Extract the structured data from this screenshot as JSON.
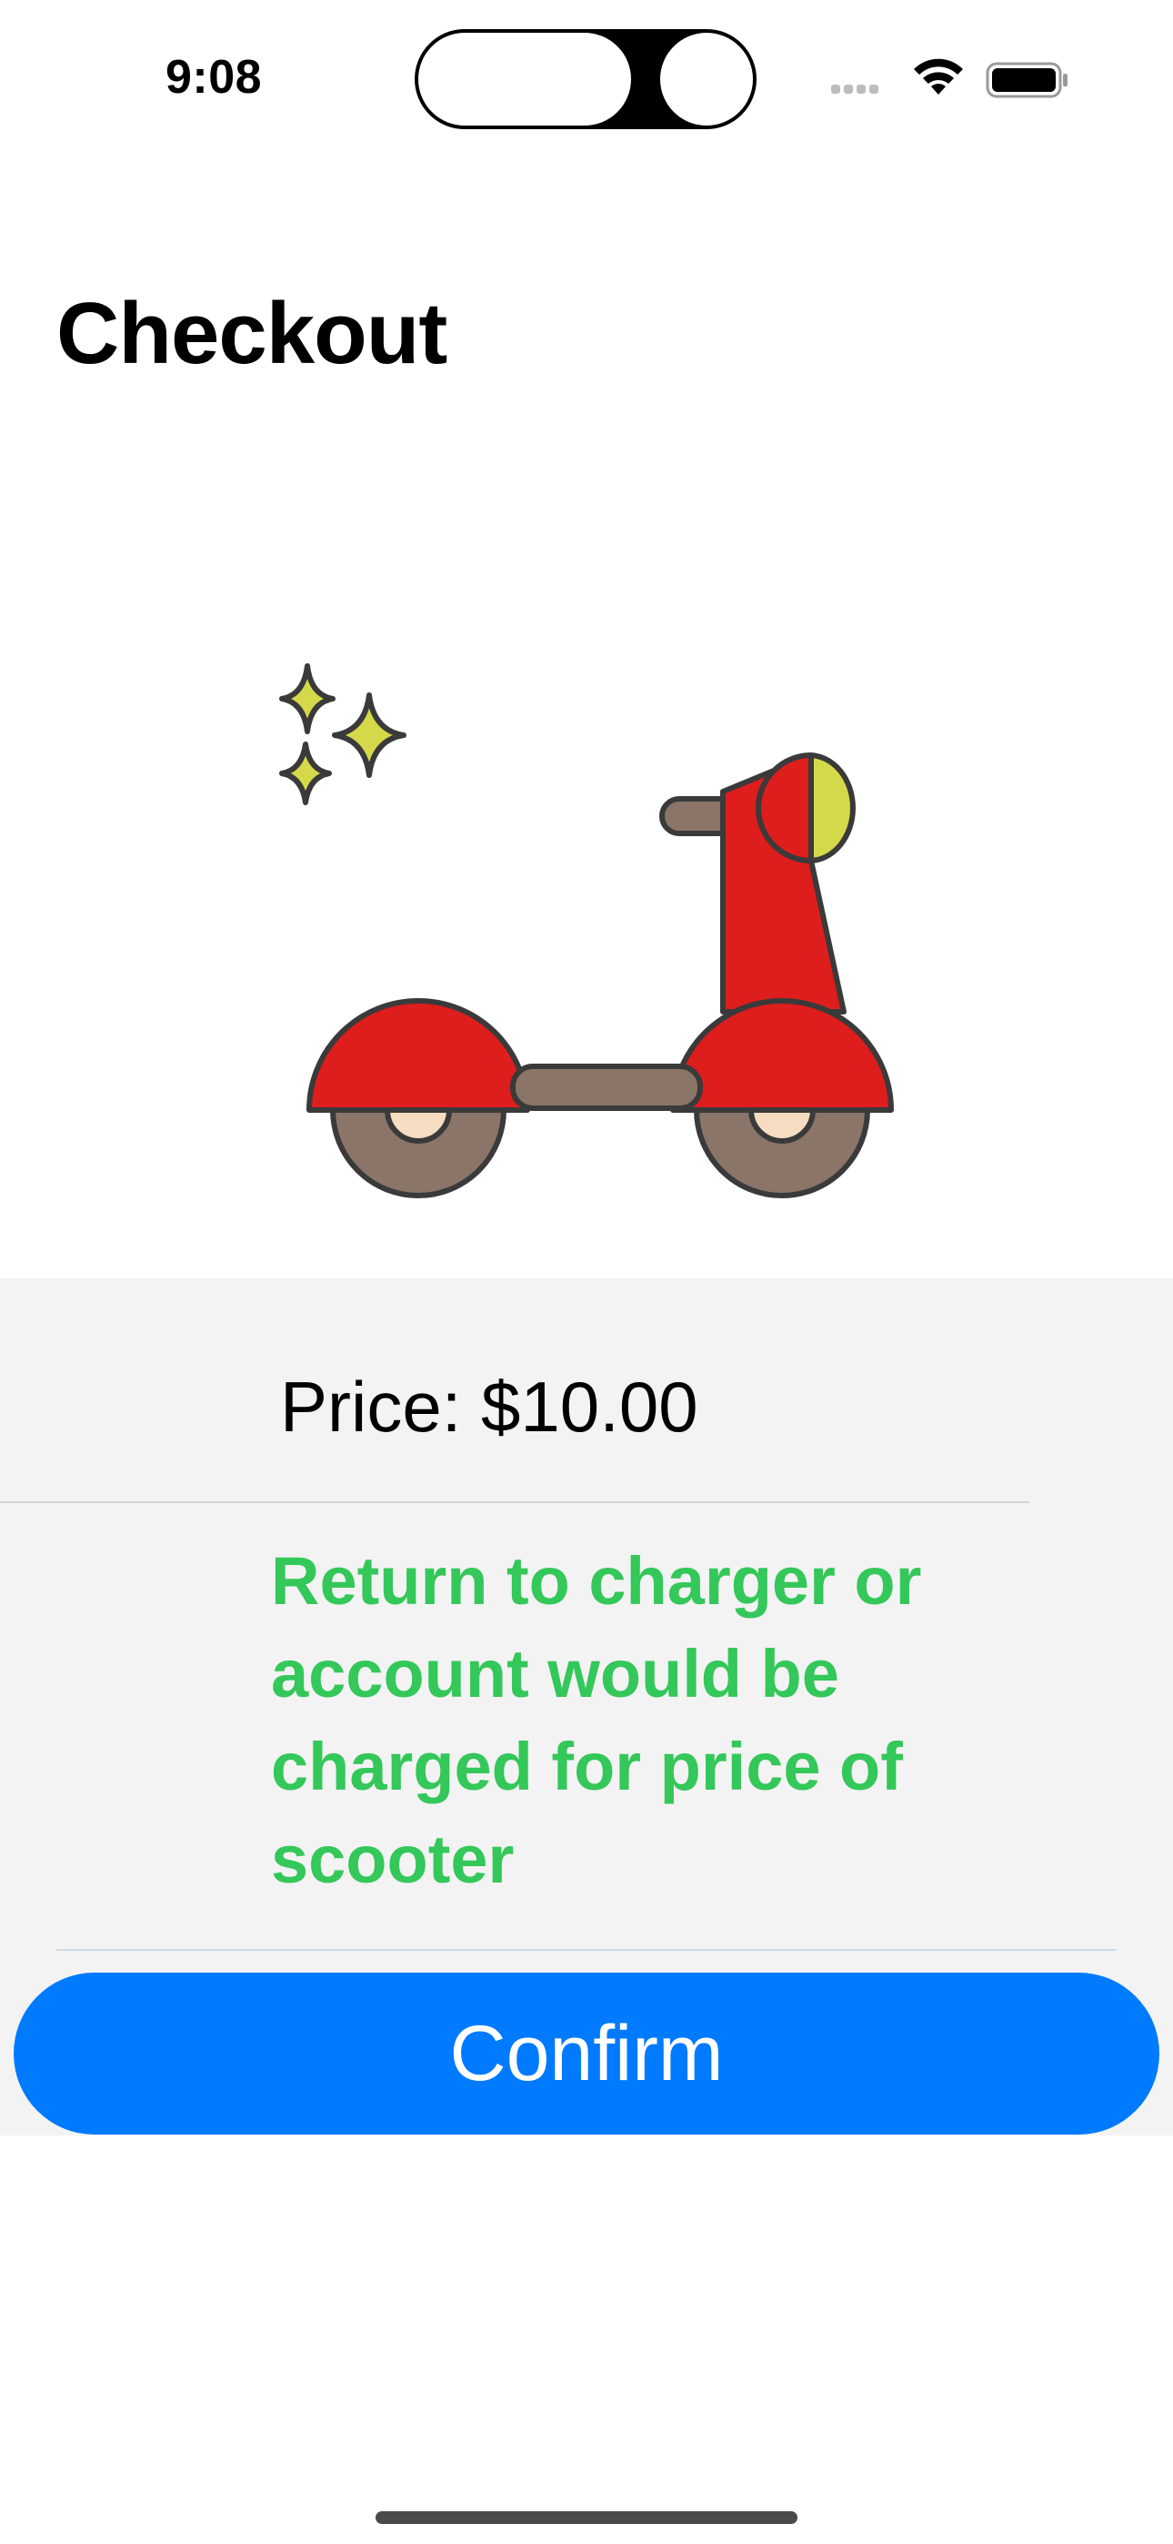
{
  "status_bar": {
    "time": "9:08",
    "icons": [
      "cellular-signal-icon",
      "wifi-icon",
      "battery-icon"
    ]
  },
  "header": {
    "title": "Checkout"
  },
  "illustration": {
    "name": "scooter-sparkles-illustration"
  },
  "checkout": {
    "price_label": "Price: $10.00",
    "warning": "Return to charger or account would be charged for price of scooter",
    "confirm_label": "Confirm"
  },
  "colors": {
    "accent": "#007aff",
    "warning_text": "#34c759",
    "panel_bg": "#f3f3f3"
  }
}
